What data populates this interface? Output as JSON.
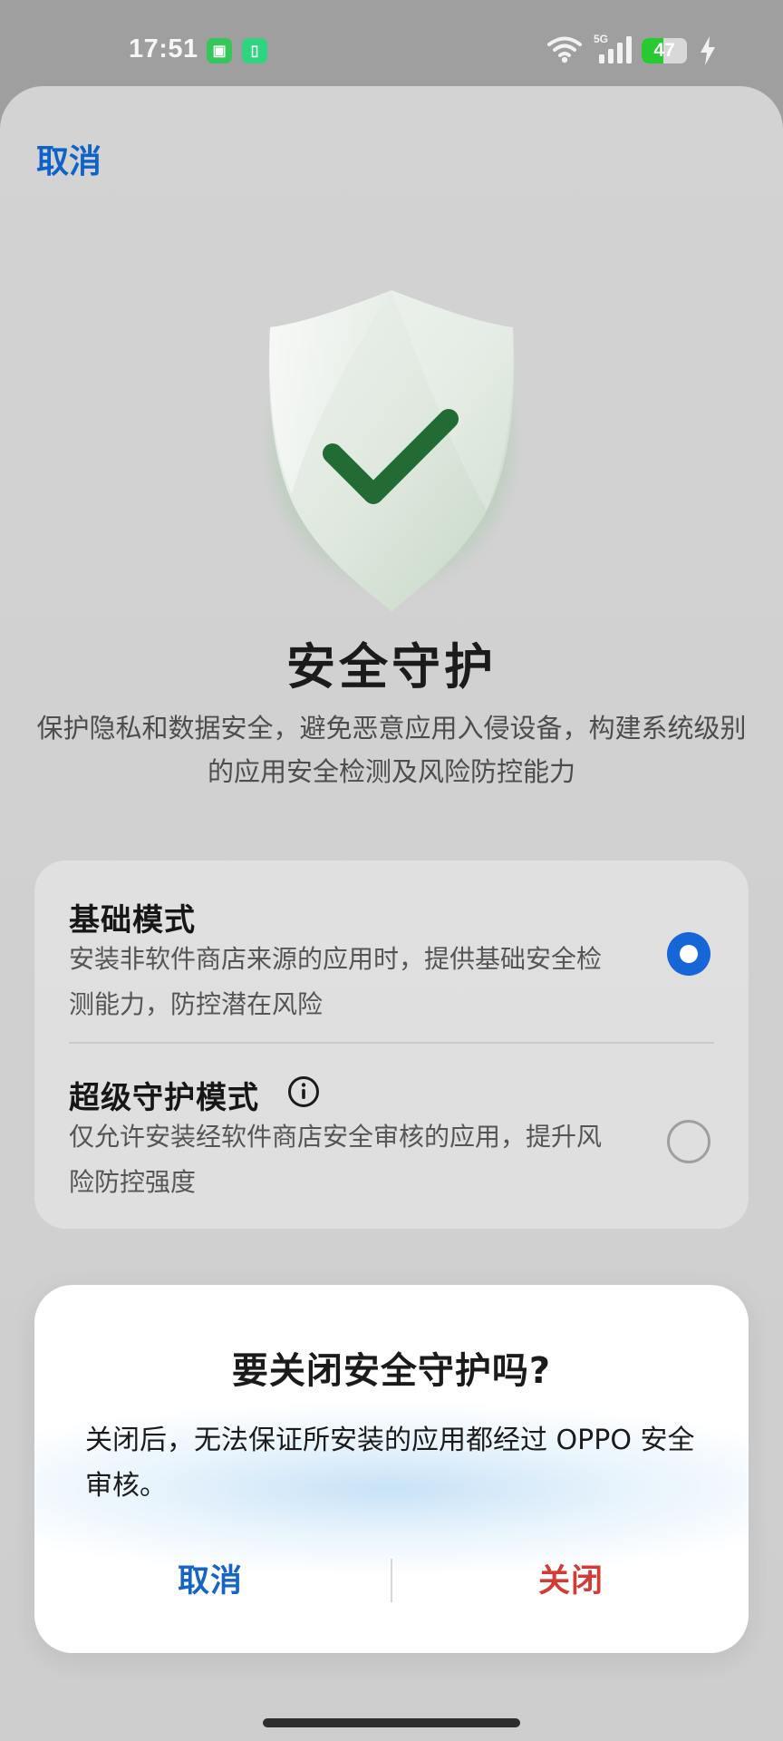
{
  "status_bar": {
    "time": "17:51",
    "signal": "5G",
    "battery_percent": 47
  },
  "top": {
    "cancel_label": "取消"
  },
  "hero": {
    "title": "安全守护",
    "description": "保护隐私和数据安全，避免恶意应用入侵设备，构建系统级别的应用安全检测及风险防控能力"
  },
  "modes": {
    "basic": {
      "title": "基础模式",
      "description": "安装非软件商店来源的应用时，提供基础安全检测能力，防控潜在风险",
      "selected": true
    },
    "super": {
      "title": "超级守护模式",
      "description": "仅允许安装经软件商店安全审核的应用，提升风险防控强度",
      "selected": false
    }
  },
  "dialog": {
    "title": "要关闭安全守护吗?",
    "message": "关闭后，无法保证所安装的应用都经过 OPPO 安全审核。",
    "cancel_label": "取消",
    "confirm_label": "关闭"
  },
  "icons": {
    "notification_1": "app-notification-icon",
    "notification_2": "battery-notification-icon",
    "wifi": "wifi-icon",
    "signal": "signal-icon",
    "charging": "charging-icon",
    "shield": "shield-check-icon",
    "info": "info-icon"
  },
  "colors": {
    "primary_blue": "#1564C8",
    "danger_red": "#D63A35",
    "success_green": "#29C934"
  }
}
